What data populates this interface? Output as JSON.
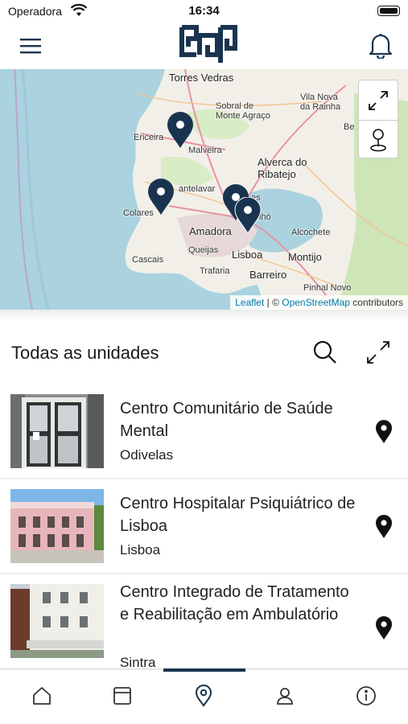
{
  "status_bar": {
    "carrier": "Operadora",
    "time": "16:34"
  },
  "header": {
    "menu_icon": "hamburger-menu-icon",
    "logo_icon": "brand-logo",
    "notifications_icon": "bell-icon"
  },
  "map": {
    "places": [
      {
        "label": "Torres Vedras",
        "size": "big"
      },
      {
        "label": "Vila Nova\nda Rainha",
        "size": "small"
      },
      {
        "label": "Sobral de\nMonte Agraço",
        "size": "small"
      },
      {
        "label": "Ericeira",
        "size": "small"
      },
      {
        "label": "Malveira",
        "size": "small"
      },
      {
        "label": "Alverca do\nRibatejo",
        "size": "big"
      },
      {
        "label": "Colares",
        "size": "small"
      },
      {
        "label": "Amadora",
        "size": "big"
      },
      {
        "label": "Alcochete",
        "size": "small"
      },
      {
        "label": "Cascais",
        "size": "small"
      },
      {
        "label": "Queijas",
        "size": "small"
      },
      {
        "label": "Lisboa",
        "size": "big"
      },
      {
        "label": "Montijo",
        "size": "big"
      },
      {
        "label": "Trafaria",
        "size": "small"
      },
      {
        "label": "Barreiro",
        "size": "big"
      },
      {
        "label": "Pinhal Novo",
        "size": "small"
      },
      {
        "label": "Be",
        "size": "small"
      },
      {
        "label": "antelavar",
        "size": "small"
      },
      {
        "label": "es",
        "size": "small"
      },
      {
        "label": "lhó",
        "size": "small"
      }
    ],
    "controls": {
      "fullscreen_icon": "collapse-arrows-icon",
      "locate_icon": "location-marker-icon"
    },
    "attribution": {
      "leaflet": "Leaflet",
      "separator": " | © ",
      "osm": "OpenStreetMap",
      "suffix": " contributors"
    },
    "pin_color": "#1a3450"
  },
  "list": {
    "title": "Todas as unidades",
    "search_icon": "search-icon",
    "expand_icon": "expand-arrows-icon",
    "units": [
      {
        "name": "Centro Comunitário de Saúde Mental",
        "location": "Odivelas"
      },
      {
        "name": "Centro Hospitalar Psiquiátrico de Lisboa",
        "location": "Lisboa"
      },
      {
        "name": "Centro Integrado de Tratamento e Reabilitação em Ambulatório",
        "location": "Sintra"
      }
    ]
  },
  "tab_bar": {
    "tabs": [
      {
        "icon": "home-icon"
      },
      {
        "icon": "calendar-icon"
      },
      {
        "icon": "map-pin-icon",
        "active": true
      },
      {
        "icon": "user-icon"
      },
      {
        "icon": "info-icon"
      }
    ],
    "accent": "#1a3450"
  }
}
